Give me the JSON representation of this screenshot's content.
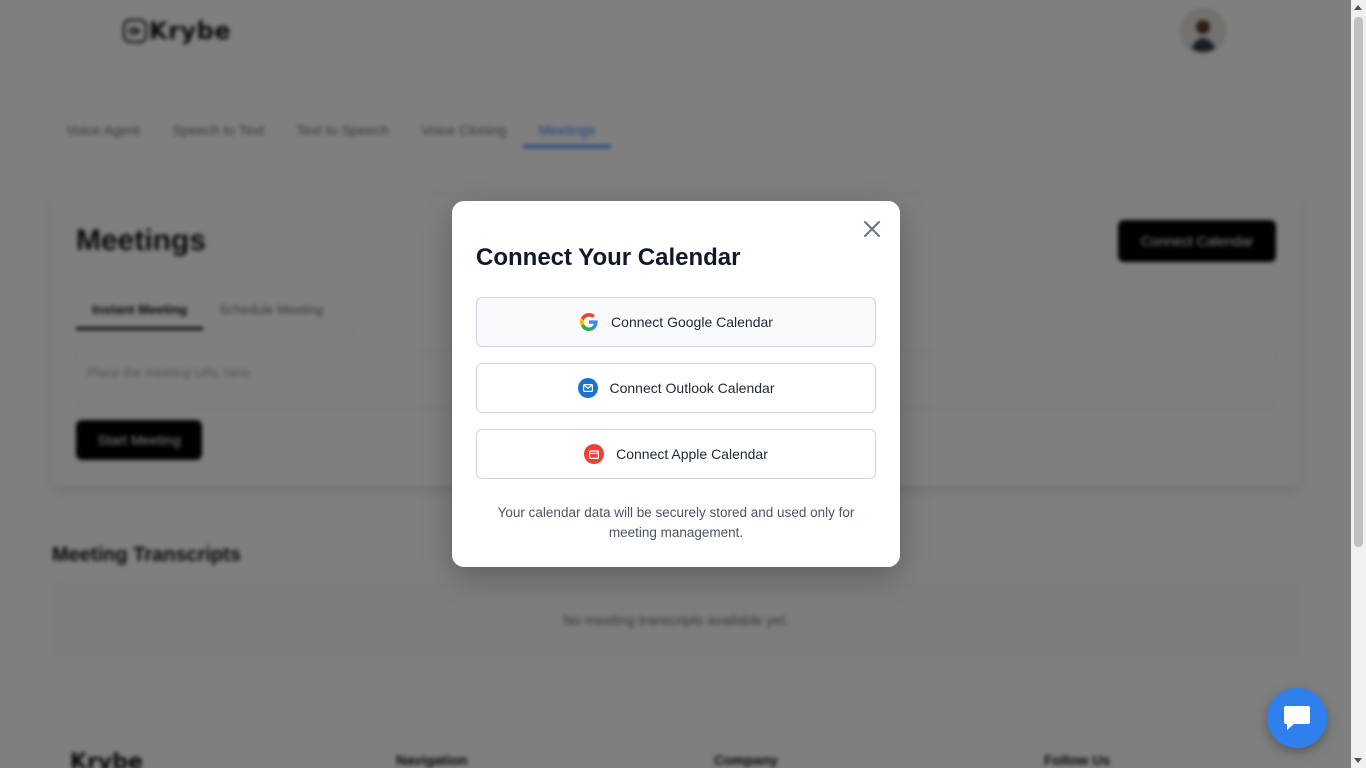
{
  "app": {
    "brand": "Krybe"
  },
  "nav": {
    "tabs": [
      {
        "label": "Voice Agent"
      },
      {
        "label": "Speech to Text"
      },
      {
        "label": "Text to Speech"
      },
      {
        "label": "Voice Cloning"
      },
      {
        "label": "Meetings",
        "active": true
      }
    ]
  },
  "meetings_card": {
    "title": "Meetings",
    "connect_button": "Connect Calendar",
    "subtabs": [
      {
        "label": "Instant Meeting",
        "active": true
      },
      {
        "label": "Schedule Meeting"
      }
    ],
    "url_placeholder": "Place the meeting URL here",
    "start_button": "Start Meeting"
  },
  "transcripts": {
    "title": "Meeting Transcripts",
    "empty_text": "No meeting transcripts available yet."
  },
  "footer": {
    "brand": "Krybe",
    "columns": [
      "Navigation",
      "Company",
      "Follow Us"
    ]
  },
  "modal": {
    "title": "Connect Your Calendar",
    "buttons": {
      "google": "Connect Google Calendar",
      "outlook": "Connect Outlook Calendar",
      "apple": "Connect Apple Calendar"
    },
    "note": "Your calendar data will be securely stored and used only for meeting management."
  },
  "icons": {
    "close": "close-icon",
    "google": "google-icon",
    "outlook": "mail-icon",
    "apple": "calendar-icon",
    "chat": "chat-icon"
  },
  "colors": {
    "accent": "#3b82f6",
    "outlook": "#1a73c9",
    "apple": "#ea4335",
    "chat": "#2f80ed",
    "overlay": "rgba(0,0,0,0.5)"
  }
}
